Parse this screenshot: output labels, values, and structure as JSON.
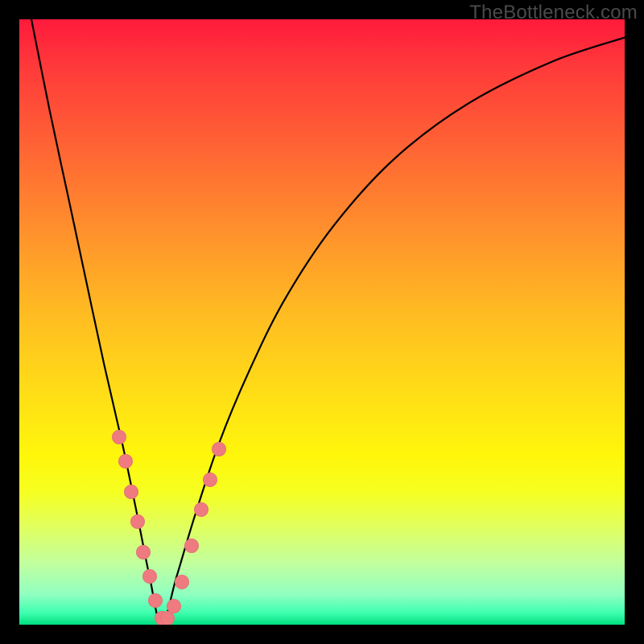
{
  "watermark": {
    "text": "TheBottleneck.com"
  },
  "chart_data": {
    "type": "line",
    "title": "",
    "xlabel": "",
    "ylabel": "",
    "x_range": [
      0,
      1
    ],
    "y_range": [
      0,
      100
    ],
    "vertex_x": 0.235,
    "series": [
      {
        "name": "bottleneck-curve",
        "x": [
          0.02,
          0.05,
          0.08,
          0.11,
          0.14,
          0.17,
          0.195,
          0.215,
          0.235,
          0.26,
          0.29,
          0.33,
          0.38,
          0.44,
          0.52,
          0.62,
          0.74,
          0.88,
          1.0
        ],
        "y": [
          100,
          85,
          71,
          57,
          43,
          30,
          18,
          8,
          0,
          8,
          18,
          30,
          42,
          54,
          66,
          77,
          86,
          93,
          97
        ]
      }
    ],
    "markers": {
      "name": "highlighted-points",
      "color": "#ef7a7f",
      "points": [
        {
          "x": 0.165,
          "y": 31
        },
        {
          "x": 0.175,
          "y": 27
        },
        {
          "x": 0.185,
          "y": 22
        },
        {
          "x": 0.195,
          "y": 17
        },
        {
          "x": 0.205,
          "y": 12
        },
        {
          "x": 0.215,
          "y": 8
        },
        {
          "x": 0.225,
          "y": 4
        },
        {
          "x": 0.235,
          "y": 1
        },
        {
          "x": 0.245,
          "y": 1
        },
        {
          "x": 0.255,
          "y": 3
        },
        {
          "x": 0.268,
          "y": 7
        },
        {
          "x": 0.285,
          "y": 13
        },
        {
          "x": 0.3,
          "y": 19
        },
        {
          "x": 0.315,
          "y": 24
        },
        {
          "x": 0.33,
          "y": 29
        }
      ]
    },
    "background_gradient": {
      "stops": [
        {
          "pos": 0.0,
          "color": "#ff1a3c"
        },
        {
          "pos": 0.5,
          "color": "#ffcc18"
        },
        {
          "pos": 0.8,
          "color": "#f0ff40"
        },
        {
          "pos": 1.0,
          "color": "#00e080"
        }
      ]
    }
  }
}
